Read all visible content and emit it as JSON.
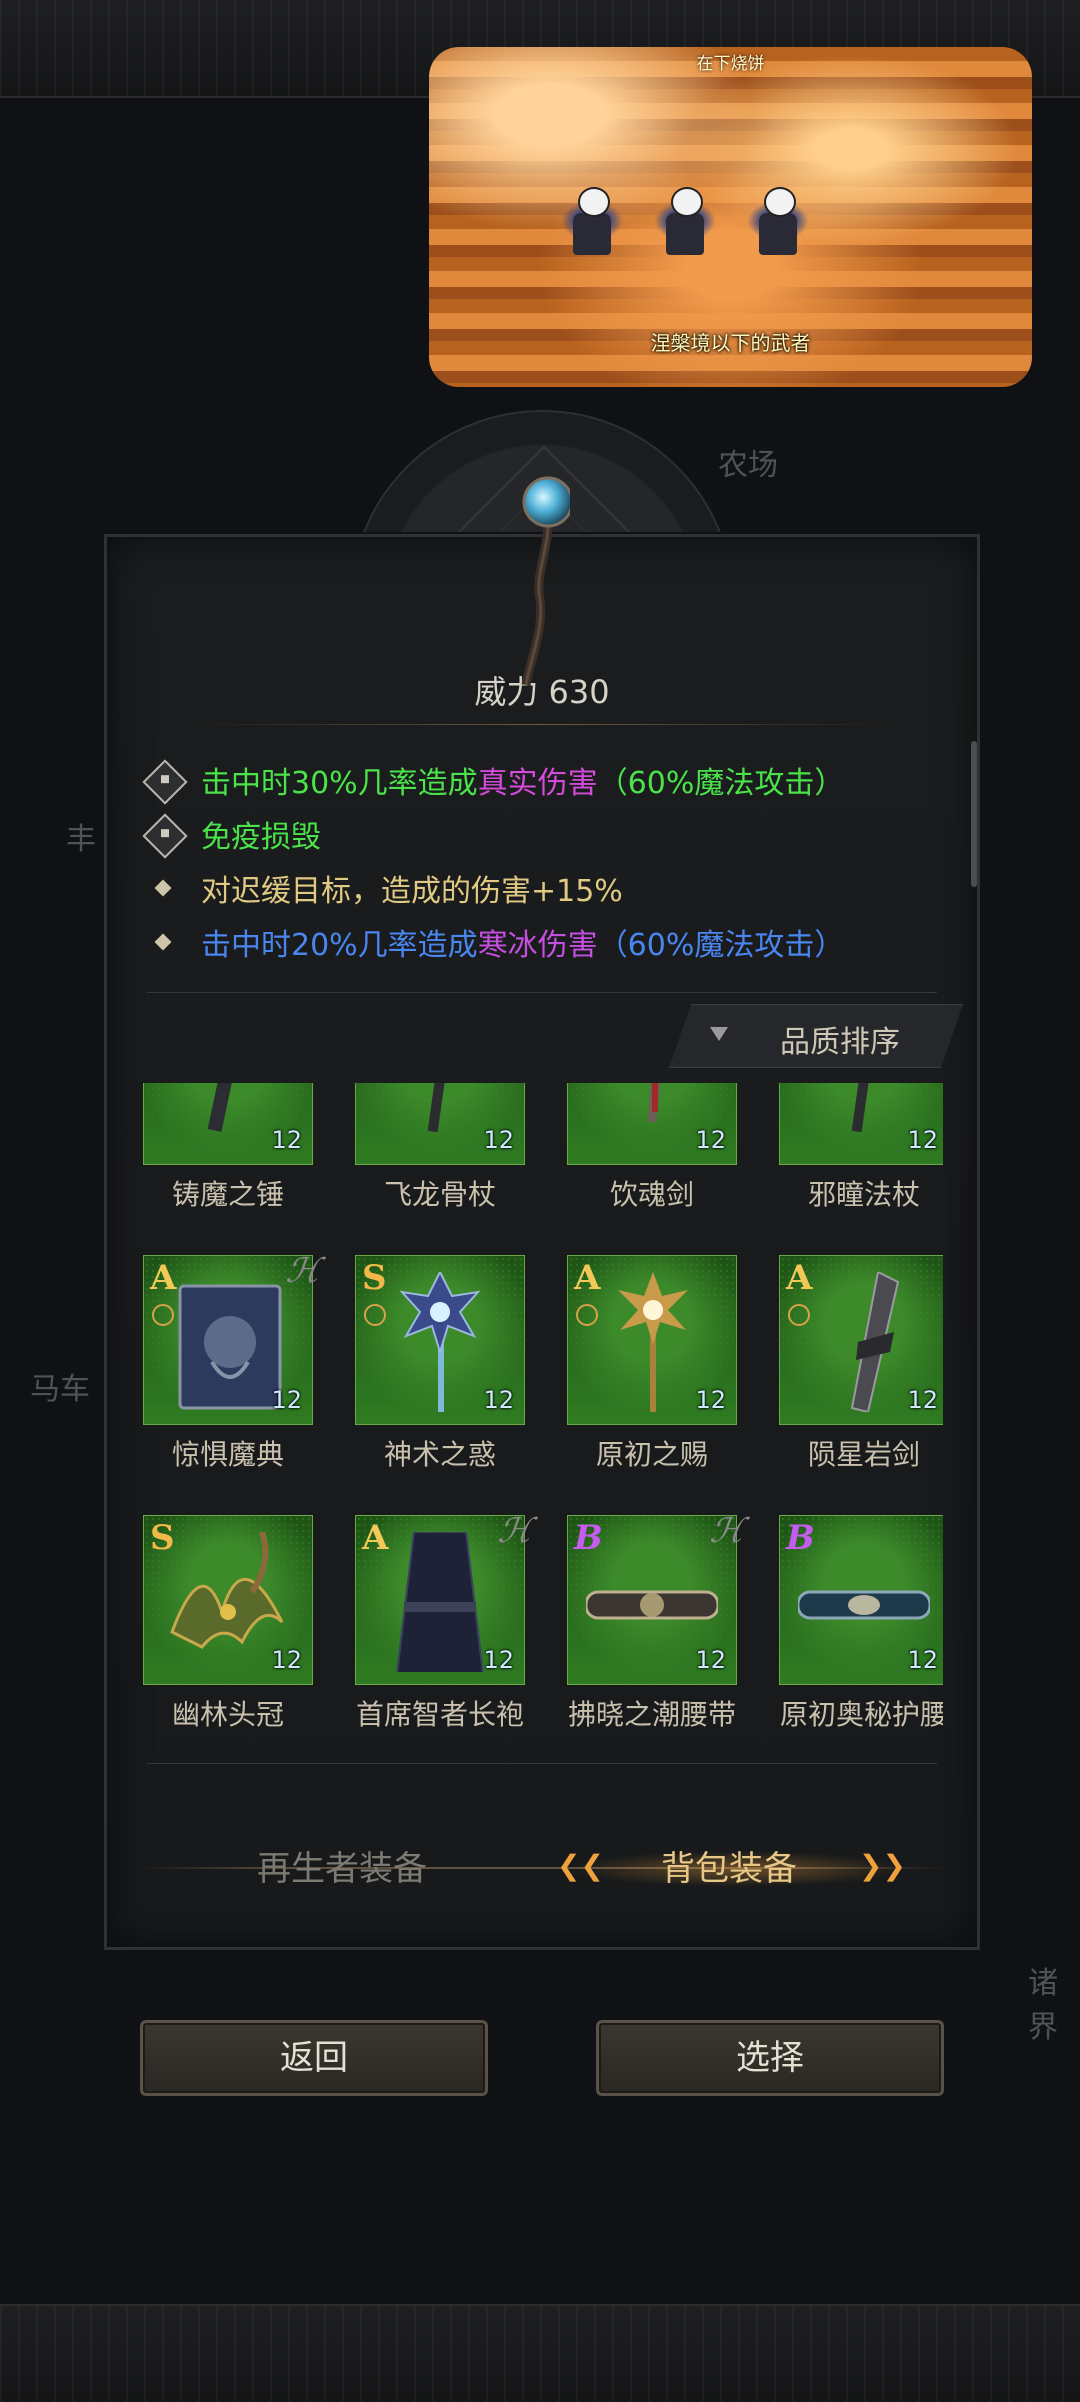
{
  "video": {
    "top_text": "在下烧饼",
    "caption": "涅槃境以下的武者"
  },
  "background": {
    "labels": [
      "农场",
      "丰",
      "马车",
      "诸界"
    ]
  },
  "weapon": {
    "power": "威力 630",
    "attributes": [
      {
        "bullet": "lock",
        "segments": [
          {
            "text": "击中时30%几率造成",
            "color": "#4be34a"
          },
          {
            "text": "真实伤害",
            "color": "#d44bd9"
          },
          {
            "text": "（60%魔法攻击）",
            "color": "#4be34a"
          }
        ]
      },
      {
        "bullet": "lock",
        "segments": [
          {
            "text": "免疫损毁",
            "color": "#4be34a"
          }
        ]
      },
      {
        "bullet": "diamond",
        "segments": [
          {
            "text": "对迟缓目标，造成的伤害+15%",
            "color": "#e0c982"
          }
        ]
      },
      {
        "bullet": "diamond",
        "segments": [
          {
            "text": "击中时20%几率造成",
            "color": "#4a86f0"
          },
          {
            "text": "寒冰伤害",
            "color": "#c54fe0"
          },
          {
            "text": "（60%魔法攻击）",
            "color": "#4a86f0"
          }
        ]
      }
    ]
  },
  "sort_button": "品质排序",
  "items": [
    {
      "name": "铸魔之锤",
      "level": "12",
      "rank": "",
      "ring": false,
      "wing": false,
      "art": "hammer"
    },
    {
      "name": "飞龙骨杖",
      "level": "12",
      "rank": "",
      "ring": false,
      "wing": false,
      "art": "staff"
    },
    {
      "name": "饮魂剑",
      "level": "12",
      "rank": "",
      "ring": false,
      "wing": false,
      "art": "sword"
    },
    {
      "name": "邪瞳法杖",
      "level": "12",
      "rank": "",
      "ring": false,
      "wing": false,
      "art": "staff"
    },
    {
      "name": "惊惧魔典",
      "level": "12",
      "rank": "A",
      "ring": true,
      "wing": true,
      "art": "book"
    },
    {
      "name": "神术之惑",
      "level": "12",
      "rank": "S",
      "ring": true,
      "wing": false,
      "art": "mace"
    },
    {
      "name": "原初之赐",
      "level": "12",
      "rank": "A",
      "ring": true,
      "wing": false,
      "art": "sunstaff"
    },
    {
      "name": "陨星岩剑",
      "level": "12",
      "rank": "A",
      "ring": true,
      "wing": false,
      "art": "bigsword"
    },
    {
      "name": "幽林头冠",
      "level": "12",
      "rank": "S",
      "ring": false,
      "wing": false,
      "art": "crown"
    },
    {
      "name": "首席智者长袍",
      "level": "12",
      "rank": "A",
      "ring": false,
      "wing": true,
      "art": "robe"
    },
    {
      "name": "拂晓之潮腰带",
      "level": "12",
      "rank": "B",
      "ring": false,
      "wing": true,
      "art": "belt"
    },
    {
      "name": "原初奥秘护腰",
      "level": "12",
      "rank": "B",
      "ring": false,
      "wing": false,
      "art": "belt2"
    }
  ],
  "tabs": {
    "regen": "再生者装备",
    "bag": "背包装备"
  },
  "buttons": {
    "back": "返回",
    "select": "选择"
  },
  "colors": {
    "accent_gold": "#e6c785",
    "item_bg_green": "#2f7c22"
  }
}
